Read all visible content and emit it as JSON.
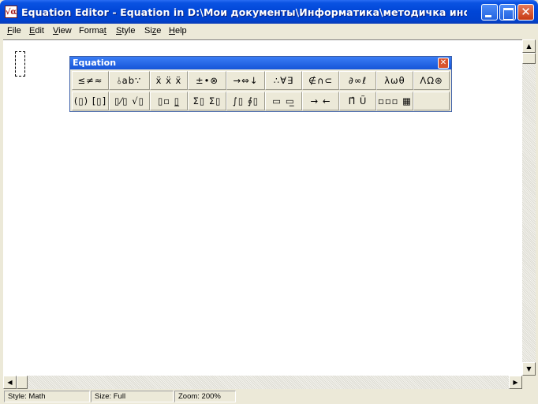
{
  "window": {
    "title": "Equation Editor - Equation in D:\\Мои документы\\Информатика\\методичка информ...",
    "app_icon_glyph": "√α",
    "minimize_icon": "minimize-icon",
    "maximize_icon": "maximize-icon",
    "close_glyph": "✕"
  },
  "menu": {
    "items": [
      {
        "accel": "F",
        "rest": "ile"
      },
      {
        "accel": "E",
        "rest": "dit"
      },
      {
        "accel": "V",
        "rest": "iew"
      },
      {
        "pre": "Forma",
        "accel": "t",
        "rest": ""
      },
      {
        "accel": "S",
        "rest": "tyle"
      },
      {
        "pre": "Si",
        "accel": "z",
        "rest": "e"
      },
      {
        "accel": "H",
        "rest": "elp"
      }
    ]
  },
  "palette": {
    "title": "Equation",
    "close_glyph": "✕",
    "row1": [
      {
        "name": "relational-symbols",
        "glyph": "≤≠≈"
      },
      {
        "name": "spaces-ellipses",
        "glyph": "⫰ab∵"
      },
      {
        "name": "embellishments",
        "glyph": "ẍ ẍ ẍ"
      },
      {
        "name": "operator-symbols",
        "glyph": "±•⊗"
      },
      {
        "name": "arrow-symbols",
        "glyph": "→⇔↓"
      },
      {
        "name": "logical-symbols",
        "glyph": "∴∀∃"
      },
      {
        "name": "set-theory-symbols",
        "glyph": "∉∩⊂"
      },
      {
        "name": "misc-symbols",
        "glyph": "∂∞ℓ"
      },
      {
        "name": "greek-lowercase",
        "glyph": "λωθ"
      },
      {
        "name": "greek-uppercase",
        "glyph": "ΛΩ⊛"
      }
    ],
    "row2": [
      {
        "name": "fence-templates",
        "glyph": "(▯) [▯]"
      },
      {
        "name": "fraction-radical-templates",
        "glyph": "▯⁄▯ √▯"
      },
      {
        "name": "subscript-superscript-templates",
        "glyph": "▯▫ ▯̲"
      },
      {
        "name": "summation-templates",
        "glyph": "Σ▯ Σ▯"
      },
      {
        "name": "integral-templates",
        "glyph": "∫▯ ∮▯"
      },
      {
        "name": "underbar-overbar-templates",
        "glyph": "▭ ▭̲"
      },
      {
        "name": "labeled-arrow-templates",
        "glyph": "→ ←"
      },
      {
        "name": "products-set-theory-templates",
        "glyph": "Π̂ Ũ"
      },
      {
        "name": "matrix-templates",
        "glyph": "▫▫▫ ▦"
      },
      {
        "name": "empty-slot",
        "glyph": ""
      }
    ]
  },
  "status": {
    "style": "Style: Math",
    "size": "Size: Full",
    "zoom": "Zoom: 200%"
  },
  "scroll": {
    "up_glyph": "▲",
    "down_glyph": "▼",
    "left_glyph": "◀",
    "right_glyph": "▶"
  }
}
